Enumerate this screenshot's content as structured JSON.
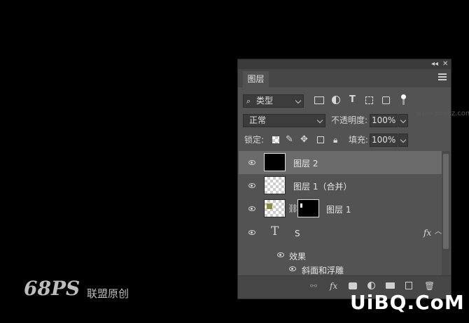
{
  "panel": {
    "tab_label": "图层",
    "collapse_icon": "double-chevron-left",
    "close_icon": "close-x",
    "filter": {
      "label": "类型",
      "icon": "search-icon"
    },
    "filter_icons": [
      "image-filter-icon",
      "adjustment-filter-icon",
      "type-filter-icon",
      "shape-filter-icon",
      "smartobject-filter-icon",
      "toggle-filter-icon"
    ],
    "blend_mode": "正常",
    "opacity_label": "不透明度:",
    "opacity_value": "100%",
    "lock_label": "锁定:",
    "fill_label": "填充:",
    "fill_value": "100%",
    "layers": [
      {
        "name": "图层 2",
        "selected": true,
        "thumb": "black"
      },
      {
        "name": "图层 1（合并）",
        "selected": false,
        "thumb": "transparent"
      },
      {
        "name": "图层 1",
        "selected": false,
        "thumb": "image-with-mask"
      },
      {
        "name": "S",
        "selected": false,
        "thumb": "text",
        "fx": "fx"
      }
    ],
    "effects_label": "效果",
    "bevel_label": "斜面和浮雕",
    "bottom_icons": [
      "link-icon",
      "fx-icon",
      "mask-icon",
      "adjustment-icon",
      "folder-icon",
      "new-layer-icon",
      "trash-icon"
    ]
  },
  "watermark_left": {
    "logo": "68PS",
    "text": "联盟原创"
  },
  "watermark_right": {
    "text": "UiBQ.CoM"
  },
  "url": "www.psanz.com"
}
